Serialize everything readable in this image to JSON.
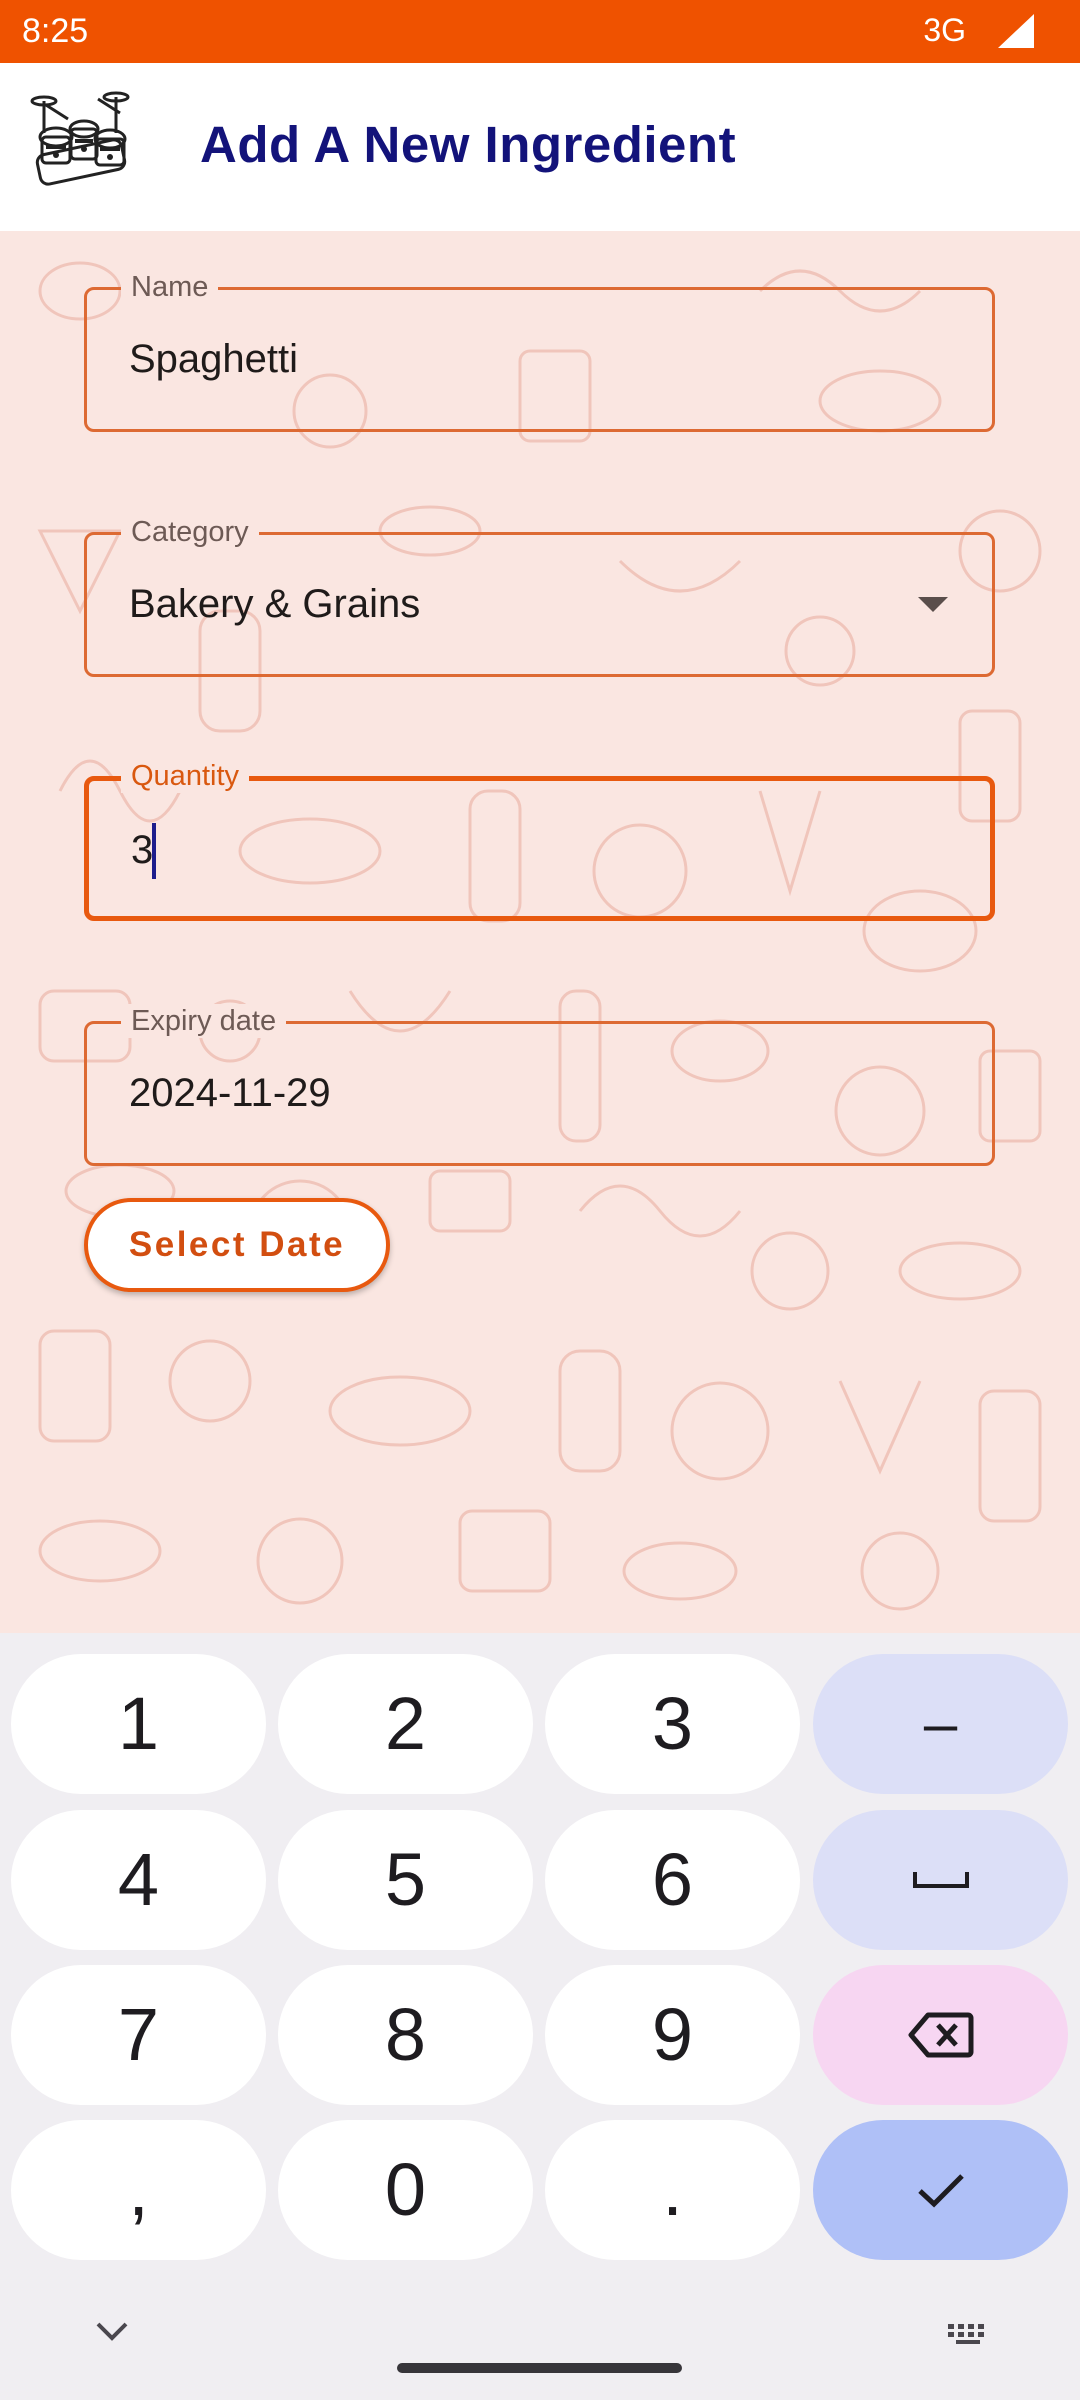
{
  "status_bar": {
    "time": "8:25",
    "network": "3G",
    "signal_icon": "cell-signal-icon"
  },
  "app_bar": {
    "title": "Add A New Ingredient",
    "logo_icon": "drum-kit-logo"
  },
  "form": {
    "name": {
      "label": "Name",
      "value": "Spaghetti"
    },
    "category": {
      "label": "Category",
      "value": "Bakery & Grains",
      "dropdown_icon": "dropdown-arrow-icon"
    },
    "quantity": {
      "label": "Quantity",
      "value": "3",
      "focused": true
    },
    "expiry": {
      "label": "Expiry date",
      "value": "2024-11-29"
    },
    "select_date_label": "Select Date"
  },
  "keyboard": {
    "row1": [
      "1",
      "2",
      "3",
      "–"
    ],
    "row2": [
      "4",
      "5",
      "6"
    ],
    "row3": [
      "7",
      "8",
      "9"
    ],
    "row4": [
      ",",
      "0",
      "."
    ],
    "space_icon": "space-icon",
    "backspace_icon": "backspace-icon",
    "done_icon": "checkmark-icon",
    "hide_icon": "chevron-down-icon",
    "switch_icon": "keyboard-icon"
  },
  "colors": {
    "accent": "#ef5200",
    "title": "#13137a",
    "background": "#fae6e1",
    "field_border": "#dd6a33"
  }
}
